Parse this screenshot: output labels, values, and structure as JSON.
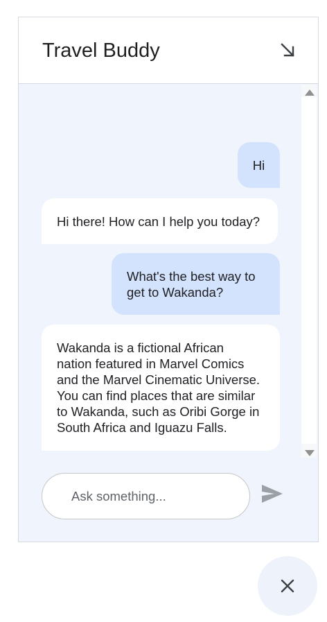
{
  "header": {
    "title": "Travel Buddy",
    "minimize_icon": "arrow-down-right-icon"
  },
  "messages": [
    {
      "role": "user",
      "text": "Hi"
    },
    {
      "role": "bot",
      "text": "Hi there! How can I help you today?"
    },
    {
      "role": "user",
      "text": "What's the best way to\nget to Wakanda?"
    },
    {
      "role": "bot",
      "text": "Wakanda is a fictional African\nnation featured in Marvel Comics\nand the Marvel Cinematic Universe.\nYou can find places that are similar\nto Wakanda, such as Oribi Gorge in\nSouth Africa and Iguazu Falls."
    }
  ],
  "composer": {
    "placeholder": "Ask something...",
    "value": "",
    "send_icon": "send-icon"
  },
  "fab": {
    "icon": "close-icon"
  },
  "colors": {
    "panel_bg": "#f0f4fc",
    "user_bubble": "#d3e2fd",
    "bot_bubble": "#ffffff",
    "border": "#d6d9de"
  }
}
